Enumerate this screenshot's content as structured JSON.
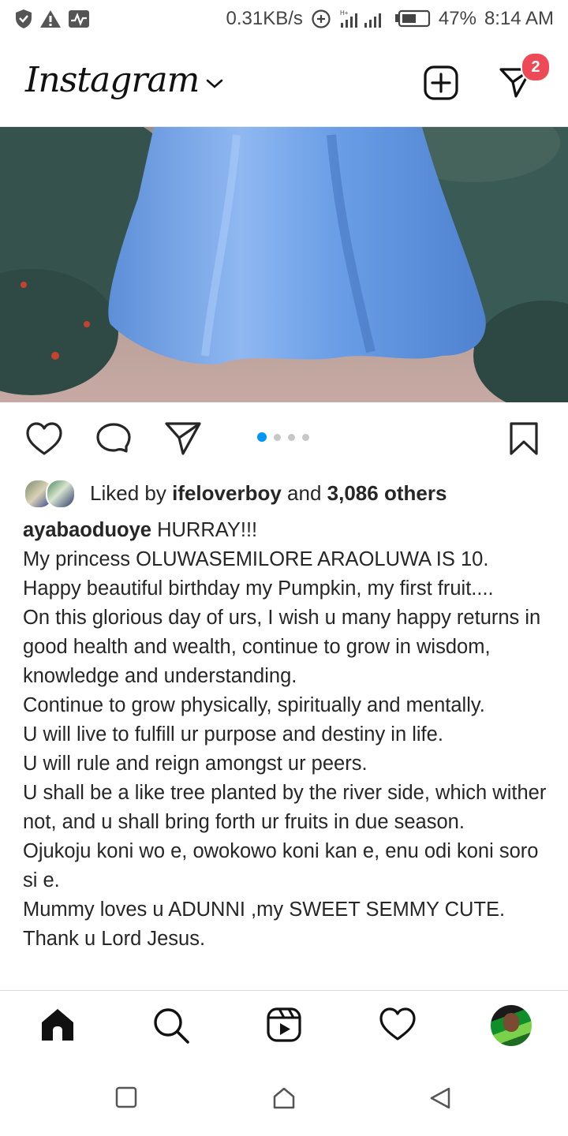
{
  "status_bar": {
    "network_speed": "0.31KB/s",
    "battery": "47%",
    "time": "8:14 AM"
  },
  "header": {
    "logo": "Instagram",
    "dm_badge_count": "2"
  },
  "post": {
    "carousel": {
      "total": 4,
      "active_index": 0
    },
    "likes": {
      "prefix": "Liked by",
      "user": "ifeloverboy",
      "conj": "and",
      "others": "3,086 others"
    },
    "caption": {
      "username": "ayabaoduoye",
      "first": "HURRAY!!!",
      "lines": [
        "My princess OLUWASEMILORE ARAOLUWA IS 10.",
        "Happy beautiful birthday my Pumpkin, my first fruit....",
        "On this glorious day of urs, I wish u many happy returns in good health and wealth, continue to grow in wisdom, knowledge and understanding.",
        "Continue to grow physically, spiritually and mentally.",
        "U will live to fulfill ur purpose and destiny in life.",
        "U will rule and reign amongst ur peers.",
        "U shall be a like tree planted by the river side, which wither not, and u shall bring forth ur fruits in due season.",
        "Ojukoju koni wo e, owokowo koni kan e, enu odi koni soro si e.",
        "Mummy loves u ADUNNI ,my SWEET SEMMY CUTE.",
        "Thank u Lord Jesus."
      ]
    }
  },
  "bottom_nav": {
    "items": [
      "home-icon",
      "search-icon",
      "reels-icon",
      "activity-heart-icon",
      "profile-avatar"
    ]
  },
  "colors": {
    "accent_blue": "#0095f6",
    "badge_red": "#ed4956",
    "text": "#262626"
  }
}
